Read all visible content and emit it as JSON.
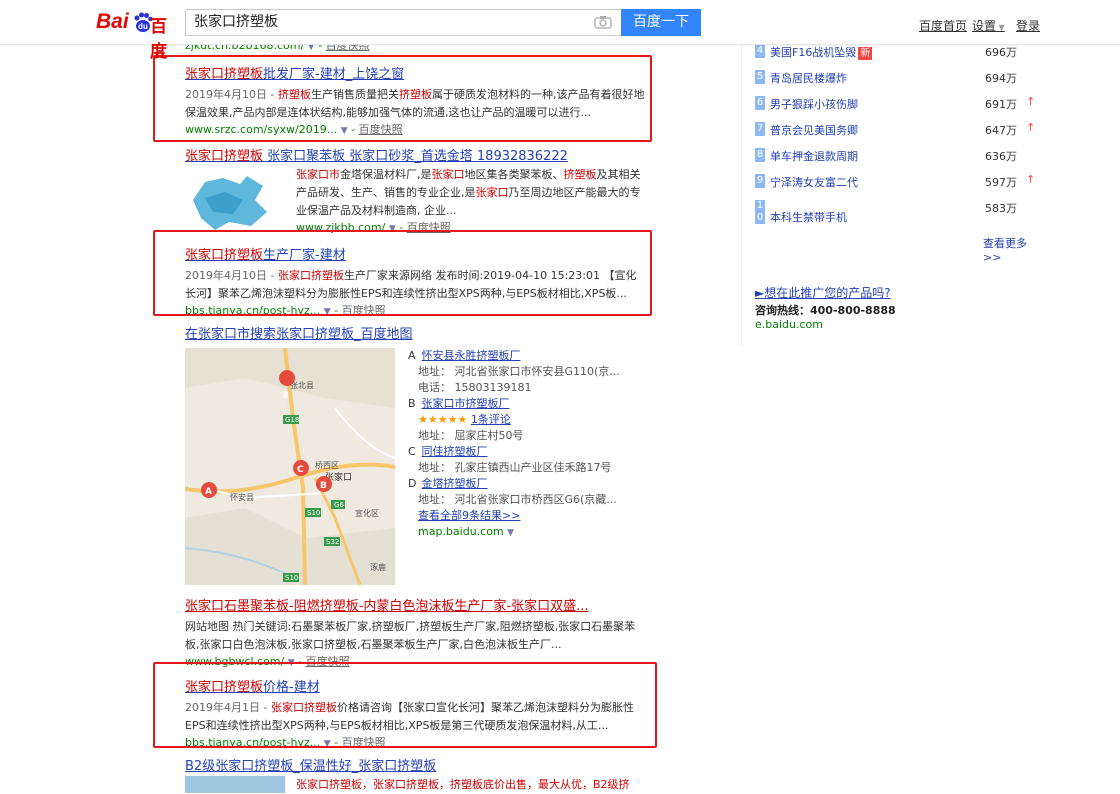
{
  "header": {
    "logo_left": "Bai",
    "logo_right": "百度",
    "search_query": "张家口挤塑板",
    "search_button": "百度一下",
    "nav_home": "百度首页",
    "nav_settings": "设置",
    "nav_login": "登录"
  },
  "results": [
    {
      "url": "zjkdt.cn.b2b168.com/",
      "snapshot": "百度快照"
    },
    {
      "title_pre": "张家口挤塑板",
      "title_mid": "批发厂家-建材_上饶之窗",
      "date": "2019年4月10日 - ",
      "abs_hl": "挤塑板",
      "abs_1": "生产销售质量把关",
      "abs_hl2": "挤塑板",
      "abs_2": "属于硬质发泡材料的一种,该产品有着很好地保温效果,产品内部是连体状结构,能够加强气体的流通,这也让产品的温暖可以进行...",
      "url": "www.srzc.com/syxw/2019...",
      "snapshot": "百度快照"
    },
    {
      "title_a": "张家口挤塑板",
      "title_b": " 张家口聚苯板 张家口砂浆_首选金塔 18932836222",
      "abs_hl": "张家口市",
      "abs_1": "金塔保温材料厂,是",
      "abs_hl2": "张家口",
      "abs_2": "地区集各类聚苯板、",
      "abs_hl3": "挤塑板",
      "abs_3": "及其相关产品研发、生产、销售的专业企业,是",
      "abs_hl4": "张家口",
      "abs_4": "乃至周边地区产能最大的专业保温产品及材料制造商, 企业...",
      "url": "www.zjkbb.com/",
      "snapshot": "百度快照"
    },
    {
      "title_pre": "张家口挤塑板",
      "title_mid": "生产厂家-建材",
      "date": "2019年4月10日 - ",
      "abs_hl": "张家口挤塑板",
      "abs_1": "生产厂家来源网络 发布时间:2019-04-10 15:23:01 【宣化长河】聚苯乙烯泡沫塑料分为膨胀性EPS和连续性挤出型XPS两种,与EPS板材相比,XPS板...",
      "url": "bbs.tianya.cn/post-hyz...",
      "snapshot": "百度快照"
    },
    {
      "title_a": "在张家口市搜索张家口挤塑板_百度地图",
      "places": [
        {
          "letter": "A",
          "name": "怀安县永胜挤塑板厂",
          "addr": "地址：  河北省张家口市怀安县G110(京...",
          "phone": "电话：  15803139181"
        },
        {
          "letter": "B",
          "name": "张家口市挤塑板厂",
          "stars": "★★★★★",
          "reviews": "1条评论",
          "addr": "地址：  屈家庄村50号"
        },
        {
          "letter": "C",
          "name": "同佳挤塑板厂",
          "addr": "地址：  孔家庄镇西山产业区佳禾路17号"
        },
        {
          "letter": "D",
          "name": "金塔挤塑板厂",
          "addr": "地址：  河北省张家口市桥西区G6(京藏..."
        }
      ],
      "see_all": "查看全部9条结果>>",
      "url": "map.baidu.com"
    },
    {
      "title": "张家口石墨聚苯板-阻燃挤塑板-内蒙白色泡沫板生产厂家-张家口双盛...",
      "abs": "网站地图 热门关键词:石墨聚苯板厂家,挤塑板厂,挤塑板生产厂家,阻燃挤塑板,张家口石墨聚苯板,张家口白色泡沫板,张家口挤塑板,石墨聚苯板生产厂家,白色泡沫板生产厂...",
      "url": "www.bgbwcl.com/",
      "snapshot": "百度快照"
    },
    {
      "title_pre": "张家口挤塑板",
      "title_mid": "价格-建材",
      "date": "2019年4月1日 - ",
      "abs_hl": "张家口挤塑板",
      "abs_1": "价格请咨询【张家口宣化长河】聚苯乙烯泡沫塑料分为膨胀性EPS和连续性挤出型XPS两种,与EPS板材相比,XPS板是第三代硬质发泡保温材料,从工...",
      "url": "bbs.tianya.cn/post-hyz...",
      "snapshot": "百度快照"
    },
    {
      "title": "B2级张家口挤塑板_保温性好_张家口挤塑板",
      "abs": "张家口挤塑板，张家口挤塑板，挤塑板底价出售，最大从优，B2级挤"
    }
  ],
  "hot_list": [
    {
      "idx": "4",
      "text": "美国F16战机坠毁",
      "badge": "新",
      "count": "696万",
      "up": false
    },
    {
      "idx": "5",
      "text": "青岛居民楼爆炸",
      "count": "694万",
      "up": false
    },
    {
      "idx": "6",
      "text": "男子狠踩小孩伤脚",
      "count": "691万",
      "up": true
    },
    {
      "idx": "7",
      "text": "普京会见美国务卿",
      "count": "647万",
      "up": true
    },
    {
      "idx": "8",
      "text": "单车押金退款周期",
      "count": "636万",
      "up": false
    },
    {
      "idx": "9",
      "text": "宁泽涛女友富二代",
      "count": "597万",
      "up": true
    },
    {
      "idx": "10",
      "text": "本科生禁带手机",
      "count": "583万",
      "up": false
    }
  ],
  "right": {
    "more": "查看更多>>",
    "promo": "►想在此推广您的产品吗?",
    "hotline": "咨询热线：400-800-8888",
    "ebaidu": "e.baidu.com"
  },
  "map_labels": {
    "zhangbei": "张北县",
    "qiaoxi": "桥西区",
    "zhangjiakou": "张家口",
    "huaian": "怀安县",
    "xuanhua": "宣化区",
    "g18": "G18",
    "s10a": "S10",
    "s10b": "S10",
    "g6": "G6",
    "s32": "S32",
    "zhuolu": "涿鹿",
    "marker_a": "A",
    "marker_b": "B",
    "marker_c": "C",
    "marker_e": "E"
  },
  "colors": {
    "accent": "#3385ff",
    "link": "#2440b3",
    "highlight": "#c00000",
    "url_green": "#008000",
    "annotation_red": "#e4181b"
  }
}
